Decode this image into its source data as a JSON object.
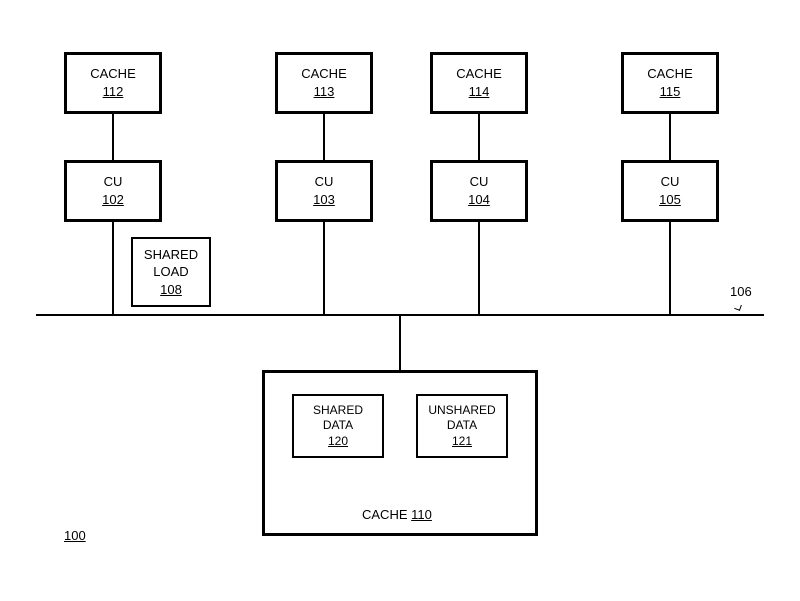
{
  "figure_number": "100",
  "bus_label": "106",
  "caches_top": [
    {
      "label": "CACHE",
      "num": "112"
    },
    {
      "label": "CACHE",
      "num": "113"
    },
    {
      "label": "CACHE",
      "num": "114"
    },
    {
      "label": "CACHE",
      "num": "115"
    }
  ],
  "cus": [
    {
      "label": "CU",
      "num": "102"
    },
    {
      "label": "CU",
      "num": "103"
    },
    {
      "label": "CU",
      "num": "104"
    },
    {
      "label": "CU",
      "num": "105"
    }
  ],
  "shared_load": {
    "line1": "SHARED",
    "line2": "LOAD",
    "num": "108"
  },
  "bottom_cache": {
    "label": "CACHE",
    "num": "110",
    "shared_data": {
      "line1": "SHARED",
      "line2": "DATA",
      "num": "120"
    },
    "unshared_data": {
      "line1": "UNSHARED",
      "line2": "DATA",
      "num": "121"
    }
  }
}
